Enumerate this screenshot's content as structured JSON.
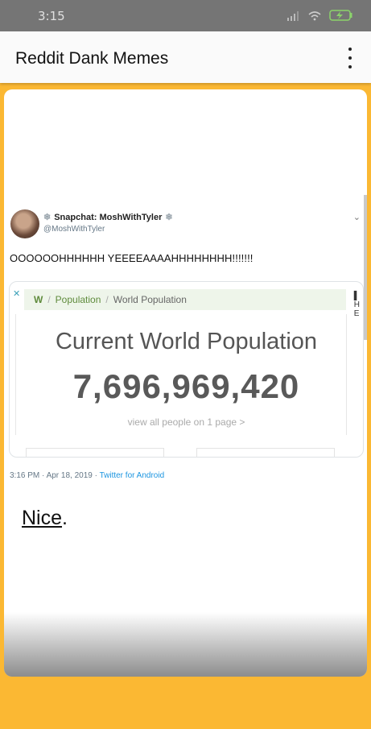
{
  "status_bar": {
    "time": "3:15",
    "icons": [
      "signal-icon",
      "wifi-icon",
      "battery-charging-icon"
    ]
  },
  "app_bar": {
    "title": "Reddit Dank Memes",
    "menu_icon": "more-vert-icon"
  },
  "colors": {
    "background": "#fbb833",
    "status_bar": "#757575",
    "app_bar": "#fafafa"
  },
  "post": {
    "tweet": {
      "display_name": "Snapchat: MoshWithTyler",
      "handle": "@MoshWithTyler",
      "text": "OOOOOOHHHHHH YEEEEAAAAHHHHHHHH!!!!!!!",
      "embed": {
        "breadcrumbs": [
          "W",
          "Population",
          "World Population"
        ],
        "heading": "Current World Population",
        "count": "7,696,969,420",
        "link": "view all people on 1 page >"
      },
      "timestamp": "3:16 PM · Apr 18, 2019 · ",
      "source": "Twitter for Android"
    },
    "caption": {
      "word": "Nice",
      "punct": "."
    }
  }
}
